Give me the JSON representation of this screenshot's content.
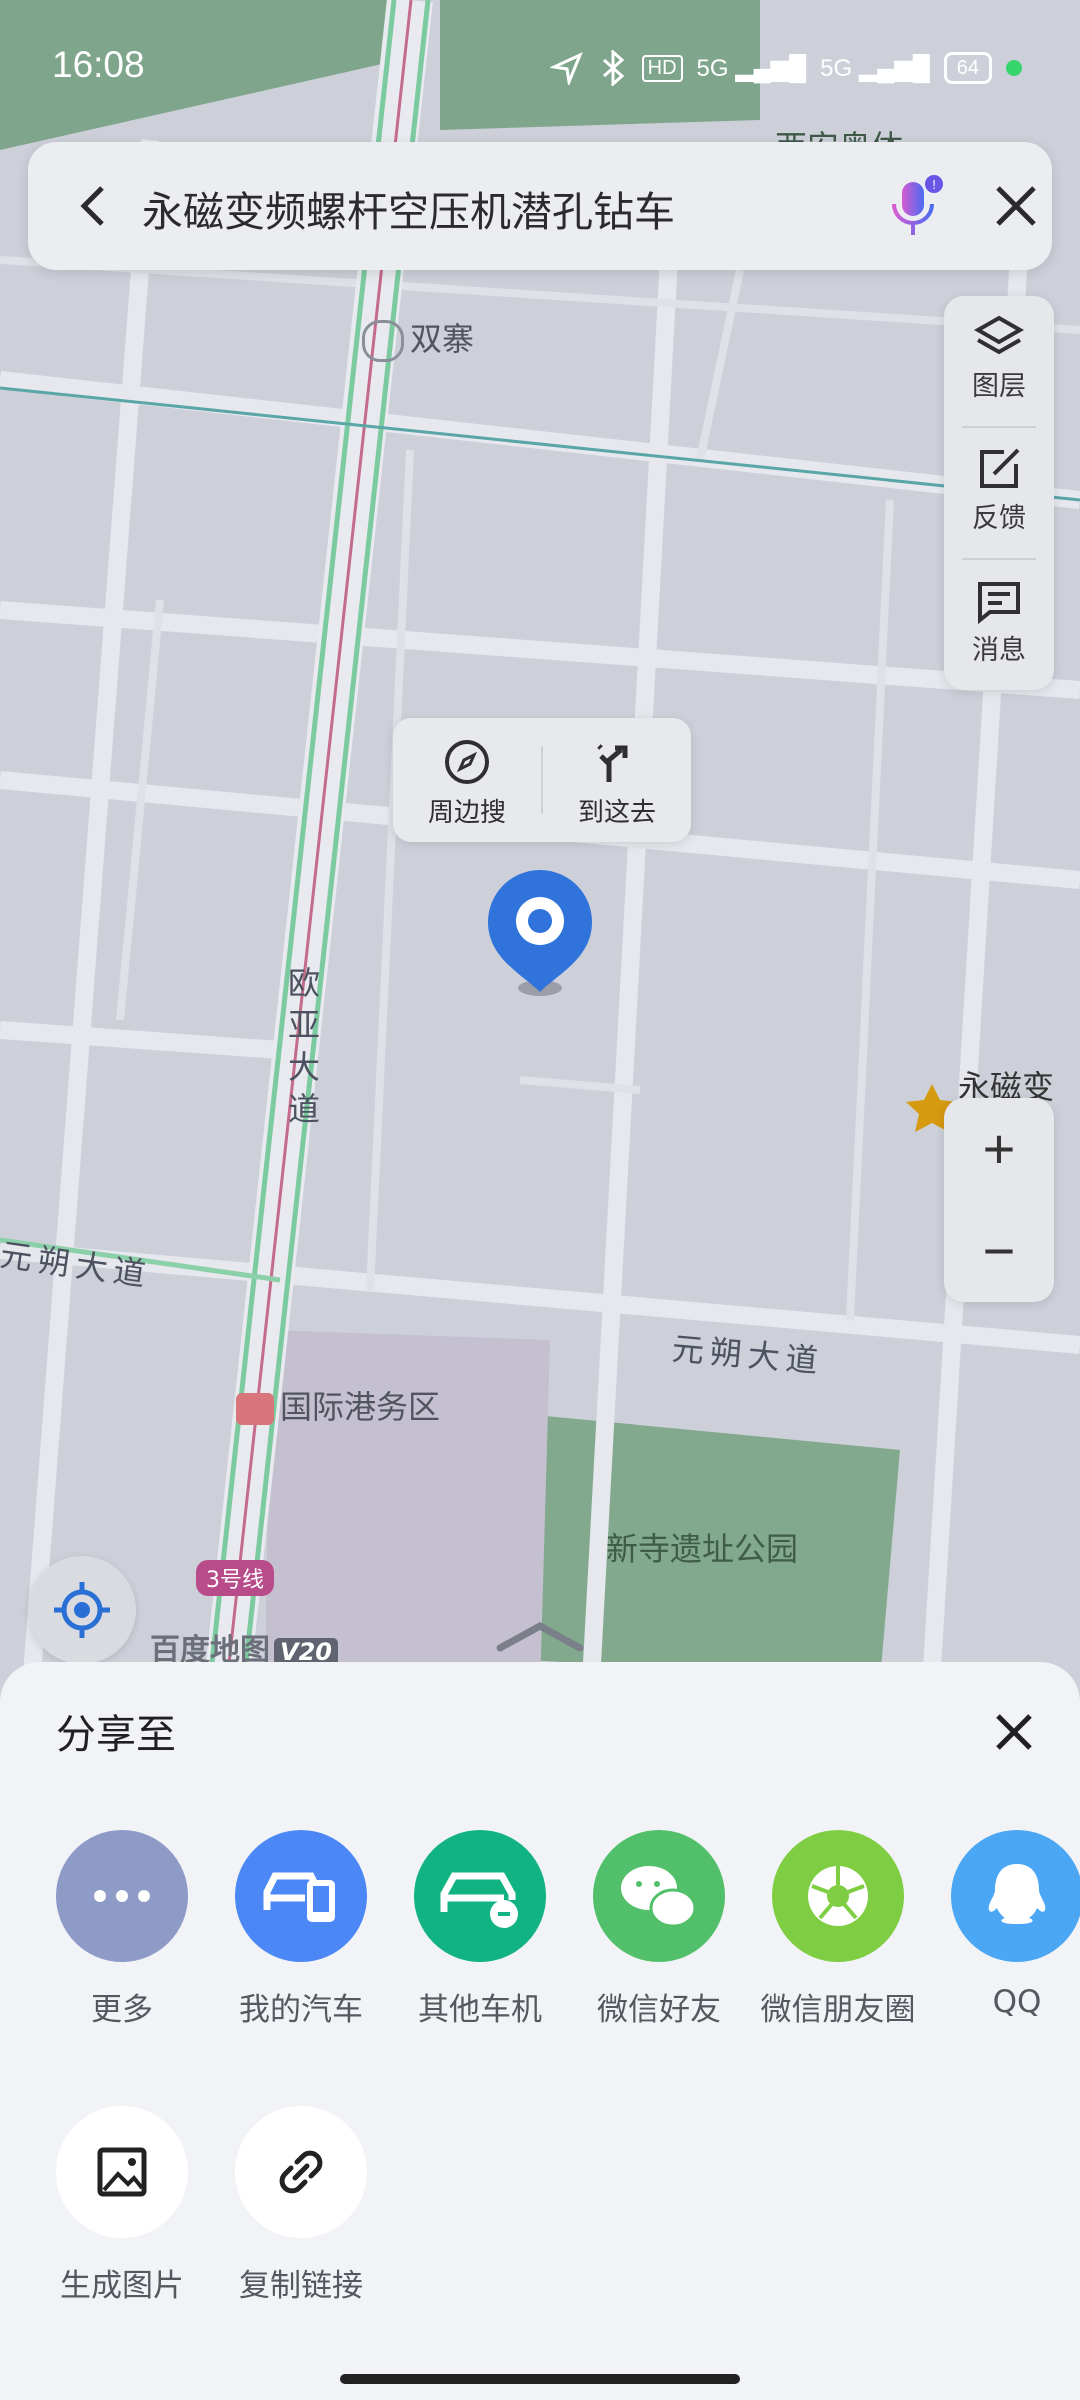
{
  "status_bar": {
    "time": "16:08",
    "network_1": "HD",
    "signal_1": "5G",
    "signal_2": "5G",
    "battery": "64"
  },
  "search": {
    "query": "永磁变频螺杆空压机潜孔钻车"
  },
  "side_tools": [
    {
      "label": "图层",
      "icon": "layers-icon"
    },
    {
      "label": "反馈",
      "icon": "feedback-icon"
    },
    {
      "label": "消息",
      "icon": "message-icon"
    }
  ],
  "popup": {
    "nearby_label": "周边搜",
    "goto_label": "到这去"
  },
  "map_labels": {
    "shuangzhai": "双寨",
    "ouya_road": "欧亚大道",
    "yuanshuo_road_left": "元朔大道",
    "yuanshuo_road_right": "元朔大道",
    "port_area": "国际港务区",
    "park": "新寺遗址公园",
    "poi_partial": "永磁变频",
    "top_partial": "西安奥体",
    "metro_line": "3号线"
  },
  "zoom": {
    "in": "+",
    "out": "−"
  },
  "brand": {
    "name": "百度地图",
    "version": "V20"
  },
  "share_sheet": {
    "title": "分享至",
    "row1": [
      {
        "label": "更多",
        "color": "#8d9bc6",
        "icon": "more-icon"
      },
      {
        "label": "我的汽车",
        "color": "#4b87f5",
        "icon": "my-car-icon"
      },
      {
        "label": "其他车机",
        "color": "#12b383",
        "icon": "car-link-icon"
      },
      {
        "label": "微信好友",
        "color": "#52c06a",
        "icon": "wechat-icon"
      },
      {
        "label": "微信朋友圈",
        "color": "#7fcd43",
        "icon": "moments-icon"
      },
      {
        "label": "QQ",
        "color": "#4ba6f4",
        "icon": "qq-icon"
      }
    ],
    "row2": [
      {
        "label": "生成图片",
        "color": "#ffffff",
        "icon": "image-icon"
      },
      {
        "label": "复制链接",
        "color": "#ffffff",
        "icon": "link-icon"
      }
    ]
  }
}
